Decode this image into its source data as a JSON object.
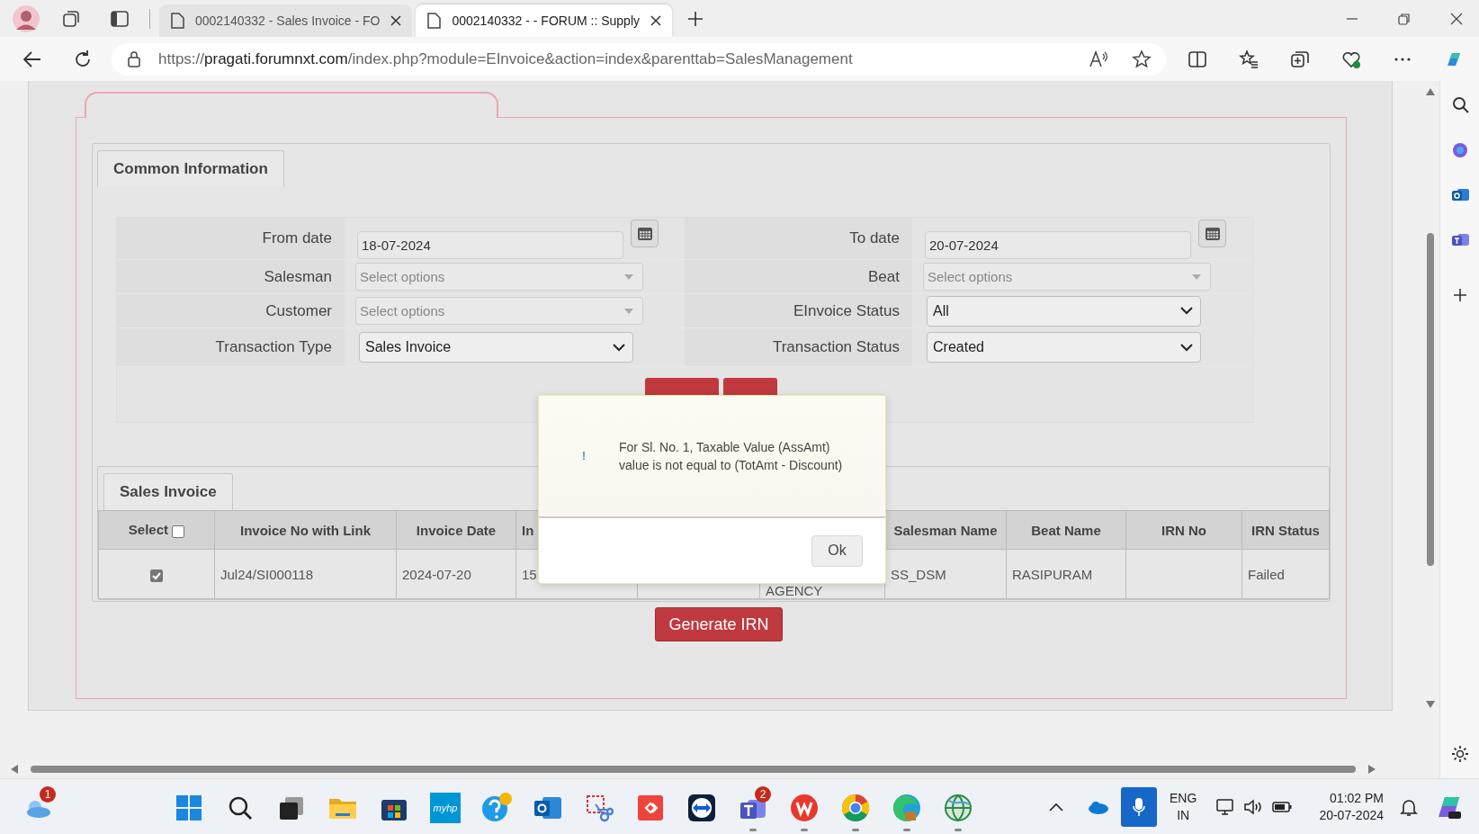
{
  "browser": {
    "tabs": [
      {
        "title": "0002140332 - Sales Invoice - FO",
        "selected": false
      },
      {
        "title": "0002140332 - - FORUM :: Supply",
        "selected": true
      }
    ],
    "url": "https://pragati.forumnxt.com/index.php?module=EInvoice&action=index&parenttab=SalesManagement"
  },
  "common_information": {
    "tab": "Common Information",
    "fields": [
      {
        "label": "From date",
        "kind": "date",
        "value": "18-07-2024"
      },
      {
        "label": "To date",
        "kind": "date",
        "value": "20-07-2024"
      },
      {
        "label": "Salesman",
        "kind": "multiselect",
        "placeholder": "Select options"
      },
      {
        "label": "Beat",
        "kind": "multiselect",
        "placeholder": "Select options"
      },
      {
        "label": "Customer",
        "kind": "multiselect",
        "placeholder": "Select options"
      },
      {
        "label": "EInvoice Status",
        "kind": "select",
        "value": "All"
      },
      {
        "label": "Transaction Type",
        "kind": "select",
        "value": "Sales Invoice"
      },
      {
        "label": "Transaction Status",
        "kind": "select",
        "value": "Created"
      }
    ]
  },
  "sales_invoice": {
    "tab": "Sales Invoice",
    "select_all": {
      "label": "Select",
      "checked": false
    },
    "columns": [
      {
        "header": "Invoice No with Link"
      },
      {
        "header": "Invoice Date"
      },
      {
        "header": "In"
      },
      {},
      {},
      {
        "header": "Salesman Name"
      },
      {
        "header": "Beat Name"
      },
      {
        "header": "IRN No"
      },
      {
        "header": "IRN Status"
      }
    ],
    "rows": [
      {
        "checked": true,
        "cells": [
          {
            "text": "Jul24/SI000118"
          },
          {
            "text": "2024-07-20"
          },
          {
            "text": "15"
          },
          {},
          {
            "text": "AGENCY"
          },
          {
            "text": "SS_DSM"
          },
          {
            "text": "RASIPURAM"
          },
          {},
          {
            "text": "Failed"
          }
        ]
      }
    ]
  },
  "generate_button": "Generate IRN",
  "dialog": {
    "icon": "!",
    "message": "For Sl. No. 1, Taxable Value (AssAmt) value is not equal to (TotAmt - Discount)",
    "button": "Ok"
  },
  "taskbar": {
    "apps": [
      {
        "kind": "weather",
        "badge": "1",
        "running": false
      },
      {
        "kind": "start",
        "running": false
      },
      {
        "kind": "search",
        "running": false
      },
      {
        "kind": "taskview",
        "running": false
      },
      {
        "kind": "folder",
        "running": false
      },
      {
        "kind": "store",
        "running": false
      },
      {
        "kind": "hp",
        "label": "myhp",
        "running": false
      },
      {
        "kind": "help",
        "running": false
      },
      {
        "kind": "mail",
        "running": false
      },
      {
        "kind": "snip",
        "running": false
      },
      {
        "kind": "diamond",
        "running": false
      },
      {
        "kind": "remote",
        "running": false
      },
      {
        "kind": "teams",
        "badge": "2",
        "running": true
      },
      {
        "kind": "office",
        "running": true
      },
      {
        "kind": "chrome",
        "running": true
      },
      {
        "kind": "edge",
        "running": true
      },
      {
        "kind": "globe",
        "running": true
      }
    ],
    "language": "ENG",
    "region": "IN",
    "time": "01:02 PM",
    "date": "20-07-2024"
  }
}
